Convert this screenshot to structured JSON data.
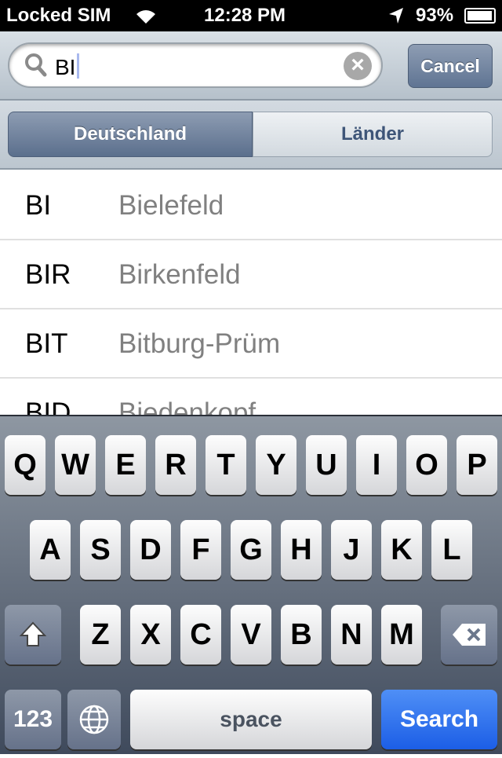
{
  "status": {
    "carrier": "Locked SIM",
    "time": "12:28 PM",
    "battery": "93%",
    "battery_level": 93
  },
  "search": {
    "value": "BI",
    "cancel_label": "Cancel"
  },
  "scope": {
    "options": [
      "Deutschland",
      "Länder"
    ],
    "selected": "Deutschland"
  },
  "results": [
    {
      "code": "BI",
      "name": "Bielefeld"
    },
    {
      "code": "BIR",
      "name": "Birkenfeld"
    },
    {
      "code": "BIT",
      "name": "Bitburg-Prüm"
    },
    {
      "code": "BID",
      "name": "Biedenkopf"
    }
  ],
  "keyboard": {
    "rows": [
      [
        "Q",
        "W",
        "E",
        "R",
        "T",
        "Y",
        "U",
        "I",
        "O",
        "P"
      ],
      [
        "A",
        "S",
        "D",
        "F",
        "G",
        "H",
        "J",
        "K",
        "L"
      ],
      [
        "Z",
        "X",
        "C",
        "V",
        "B",
        "N",
        "M"
      ]
    ],
    "numbers_label": "123",
    "space_label": "space",
    "search_label": "Search",
    "search_color": "#2a6cf0"
  }
}
